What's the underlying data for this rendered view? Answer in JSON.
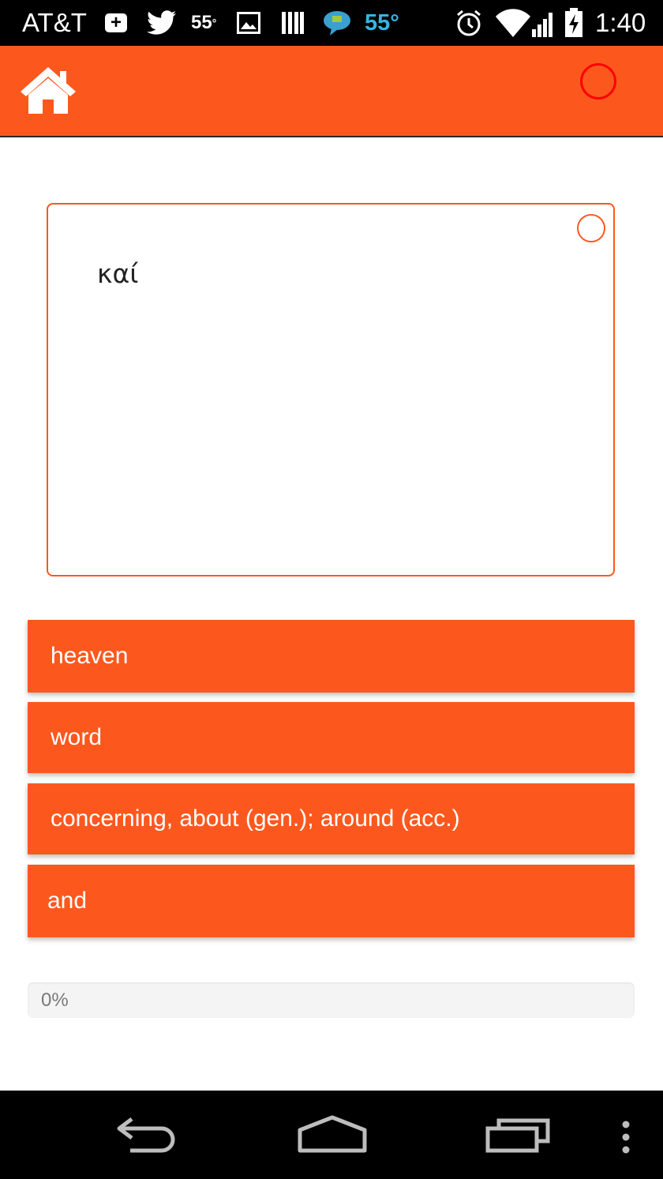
{
  "status_bar": {
    "carrier": "AT&T",
    "weather_temp_small": "55",
    "weather_temp_small_unit": "°",
    "weather_temp_large": "55°",
    "time": "1:40",
    "icons": [
      "plus-notification-icon",
      "twitter-bird-icon",
      "image-icon",
      "library-books-icon",
      "chat-bubble-icon",
      "alarm-clock-icon",
      "wifi-icon",
      "signal-icon",
      "battery-charging-icon"
    ]
  },
  "app_bar": {
    "home_icon": "home-icon",
    "status_circle_color": "#ff0000"
  },
  "card": {
    "term": "καί"
  },
  "options": [
    {
      "label": "heaven"
    },
    {
      "label": "word"
    },
    {
      "label": "concerning, about (gen.); around (acc.)"
    },
    {
      "label": "and"
    }
  ],
  "progress": {
    "value_percent": 0,
    "label": "0%"
  },
  "nav_bar": {
    "buttons": [
      "back-icon",
      "home-outline-icon",
      "recent-apps-icon",
      "overflow-menu-icon"
    ]
  },
  "colors": {
    "accent": "#fc581e",
    "status_bar_bg": "#000000",
    "weather_blue": "#33b5e5",
    "progress_track": "#f4f4f4",
    "progress_text": "#7a7a7a"
  }
}
